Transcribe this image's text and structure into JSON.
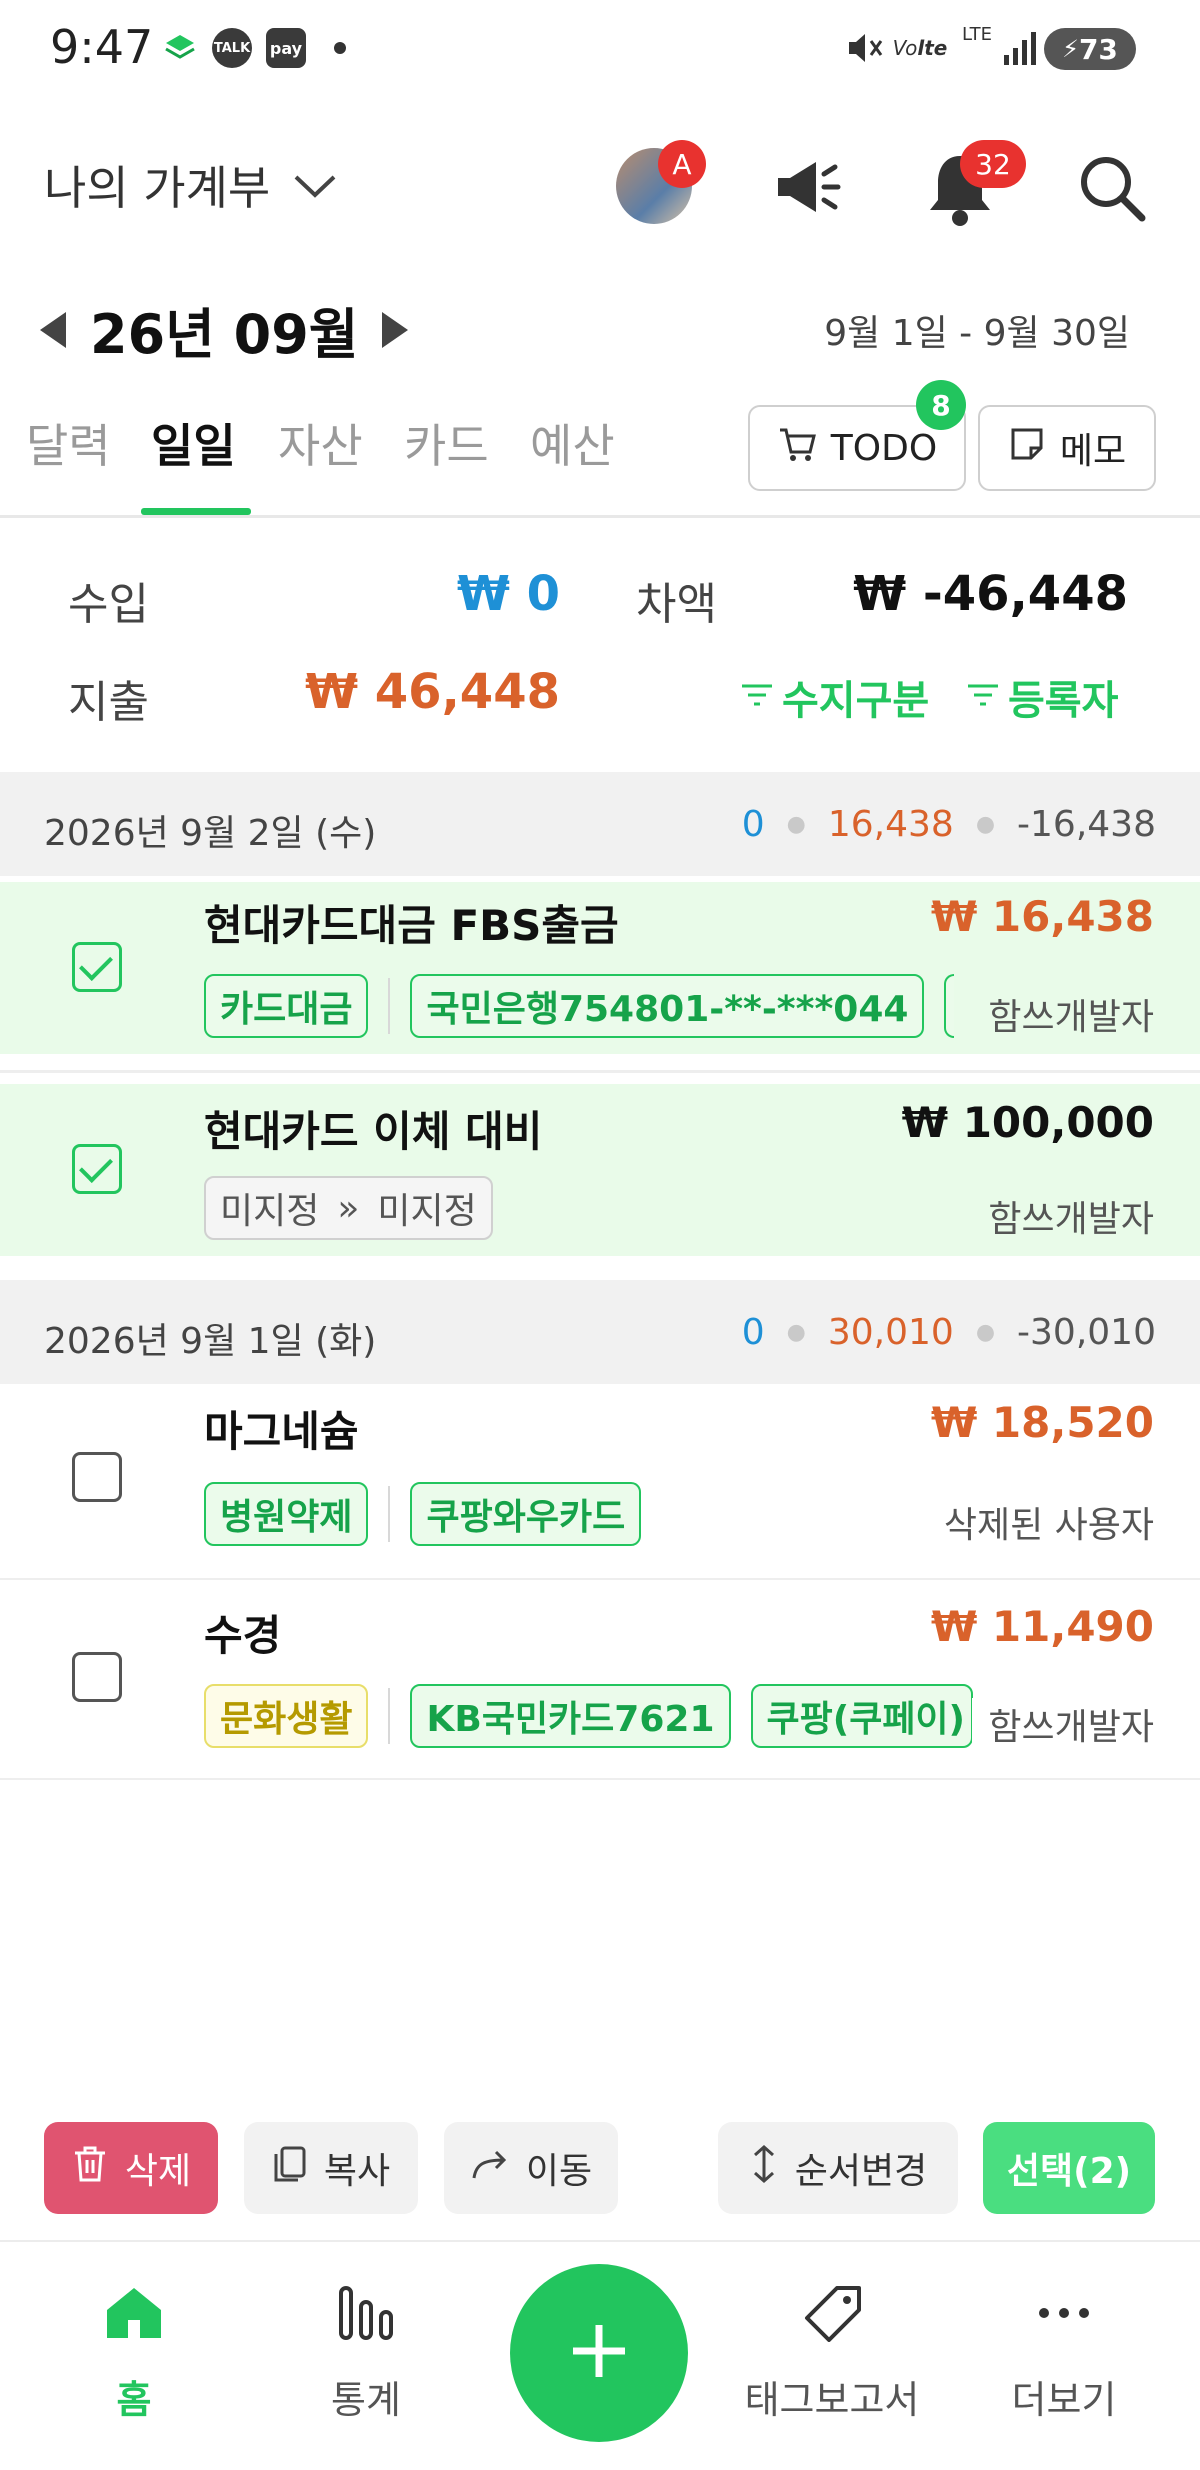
{
  "status_bar": {
    "time": "9:47",
    "battery": "73",
    "network": "LTE"
  },
  "header": {
    "title": "나의 가계부",
    "avatar_badge": "A",
    "notification_count": "32"
  },
  "period": {
    "month_label": "26년 09월",
    "date_range": "9월 1일 - 9월 30일"
  },
  "tabs": [
    {
      "label": "달력",
      "active": false
    },
    {
      "label": "일일",
      "active": true
    },
    {
      "label": "자산",
      "active": false
    },
    {
      "label": "카드",
      "active": false
    },
    {
      "label": "예산",
      "active": false
    }
  ],
  "header_buttons": {
    "todo_label": "TODO",
    "todo_badge": "8",
    "memo_label": "메모"
  },
  "summary": {
    "income_label": "수입",
    "income_value": "₩ 0",
    "expense_label": "지출",
    "expense_value": "₩ 46,448",
    "diff_label": "차액",
    "diff_value": "₩ -46,448",
    "filter_type": "수지구분",
    "filter_user": "등록자"
  },
  "days": [
    {
      "date": "2026년 9월 2일 (수)",
      "income": "0",
      "expense": "16,438",
      "total": "-16,438",
      "items": [
        {
          "title": "현대카드대금 FBS출금",
          "amount": "₩ 16,438",
          "category": "카드대금",
          "account": "국민은행754801-**-***044",
          "user": "함쓰개발자",
          "selected": true
        },
        {
          "title": "현대카드 이체 대비",
          "amount": "₩ 100,000",
          "from": "미지정",
          "to": "미지정",
          "transfer_symbol": "»",
          "user": "함쓰개발자",
          "selected": true
        }
      ]
    },
    {
      "date": "2026년 9월 1일 (화)",
      "income": "0",
      "expense": "30,010",
      "total": "-30,010",
      "items": [
        {
          "title": "마그네슘",
          "amount": "₩ 18,520",
          "category": "병원약제",
          "account": "쿠팡와우카드",
          "user": "삭제된 사용자",
          "selected": false
        },
        {
          "title": "수경",
          "amount": "₩ 11,490",
          "category": "문화생활",
          "account": "KB국민카드7621",
          "merchant": "쿠팡(쿠페이)",
          "user": "함쓰개발자",
          "selected": false
        }
      ]
    }
  ],
  "actions": {
    "delete": "삭제",
    "copy": "복사",
    "move": "이동",
    "reorder": "순서변경",
    "select": "선택(2)"
  },
  "bottom_nav": {
    "home": "홈",
    "stats": "통계",
    "tag_report": "태그보고서",
    "more": "더보기"
  },
  "colors": {
    "accent_green": "#22c55e",
    "income_blue": "#1e90d6",
    "expense_orange": "#d9622b",
    "delete_red": "#e05470"
  }
}
